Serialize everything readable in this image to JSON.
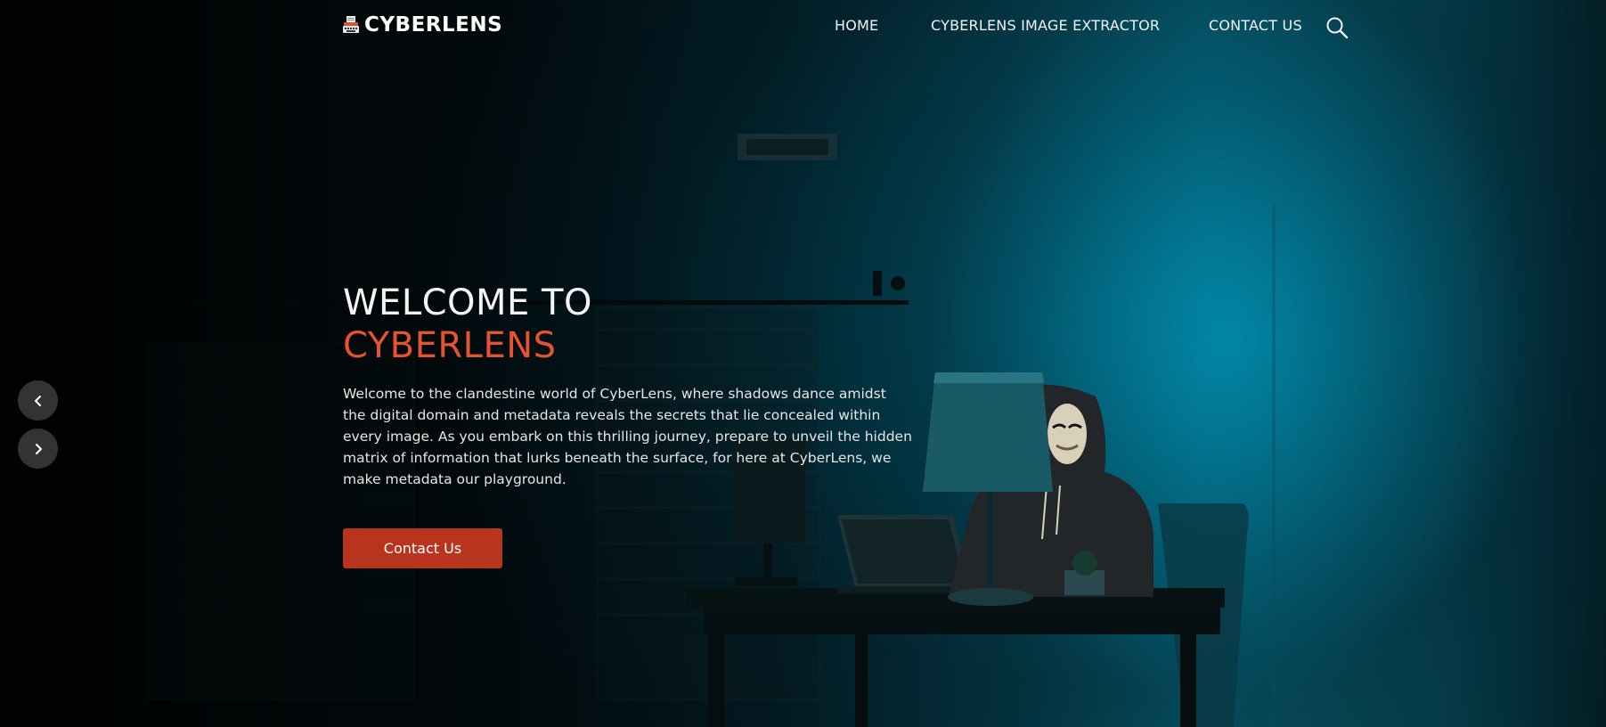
{
  "brand": {
    "name": "CYBERLENS",
    "icon": "typewriter-logo-icon"
  },
  "nav": {
    "items": [
      {
        "label": "HOME"
      },
      {
        "label": "CYBERLENS IMAGE EXTRACTOR"
      },
      {
        "label": "CONTACT US"
      }
    ],
    "search_icon": "search-icon"
  },
  "hero": {
    "title_line1": "WELCOME TO",
    "title_line2": "CYBERLENS",
    "description": "Welcome to the clandestine world of CyberLens, where shadows dance amidst the digital domain and metadata reveals the secrets that lie concealed within every image. As you embark on this thrilling journey, prepare to unveil the hidden matrix of information that lurks beneath the surface, for here at CyberLens, we make metadata our playground.",
    "cta_label": "Contact Us",
    "accent_color": "#e5532f",
    "button_color": "#b8341c"
  },
  "slider": {
    "prev_icon": "chevron-left-icon",
    "next_icon": "chevron-right-icon"
  }
}
